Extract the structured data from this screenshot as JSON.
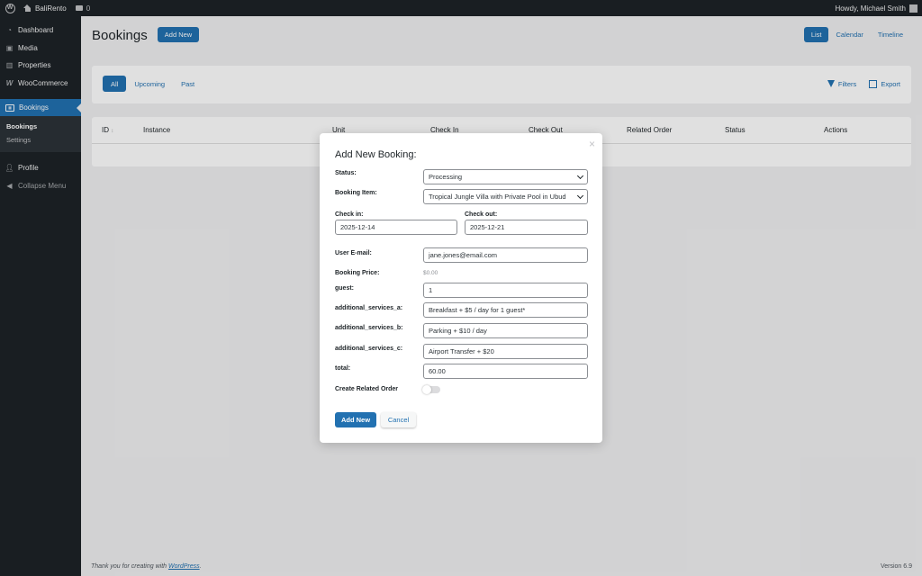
{
  "adminbar": {
    "site_name": "BaliRento",
    "comment_count": "0",
    "greeting": "Howdy, Michael Smith"
  },
  "sidebar": {
    "items": [
      {
        "label": "Dashboard",
        "icon": "dashboard-icon"
      },
      {
        "label": "Media",
        "icon": "media-icon"
      },
      {
        "label": "Properties",
        "icon": "properties-icon"
      },
      {
        "label": "WooCommerce",
        "icon": "woocommerce-icon"
      }
    ],
    "active": {
      "label": "Bookings",
      "icon": "bookings-icon"
    },
    "submenu": [
      "Bookings",
      "Settings"
    ],
    "profile": {
      "label": "Profile",
      "icon": "user-icon"
    },
    "collapse": {
      "label": "Collapse Menu",
      "icon": "collapse-icon"
    }
  },
  "page": {
    "title": "Bookings",
    "add_new": "Add New",
    "views": [
      "List",
      "Calendar",
      "Timeline"
    ],
    "filter_tabs": [
      "All",
      "Upcoming",
      "Past"
    ],
    "filters_label": "Filters",
    "export_label": "Export",
    "columns": [
      "ID",
      "Instance",
      "Unit",
      "Check In",
      "Check Out",
      "Related Order",
      "Status",
      "Actions"
    ]
  },
  "modal": {
    "title": "Add New Booking:",
    "status_label": "Status:",
    "status_value": "Processing",
    "item_label": "Booking Item:",
    "item_value": "Tropical Jungle Villa with Private Pool in Ubud",
    "checkin_label": "Check in:",
    "checkin_value": "2025-12-14",
    "checkout_label": "Check out:",
    "checkout_value": "2025-12-21",
    "email_label": "User E-mail:",
    "email_value": "jane.jones@email.com",
    "price_label": "Booking Price:",
    "price_value": "$0.00",
    "guest_label": "guest:",
    "guest_value": "1",
    "svc_a_label": "additional_services_a:",
    "svc_a_value": "Breakfast + $5 / day for 1 guest*",
    "svc_b_label": "additional_services_b:",
    "svc_b_value": "Parking + $10 / day",
    "svc_c_label": "additional_services_c:",
    "svc_c_value": "Airport Transfer + $20",
    "total_label": "total:",
    "total_value": "60.00",
    "related_order_label": "Create Related Order",
    "add_button": "Add New",
    "cancel_button": "Cancel",
    "close_glyph": "×"
  },
  "footer": {
    "thanks_prefix": "Thank you for creating with ",
    "thanks_link": "WordPress",
    "thanks_suffix": ".",
    "version": "Version 6.9"
  },
  "colors": {
    "accent": "#2271b1",
    "adminbar": "#1d2327"
  }
}
